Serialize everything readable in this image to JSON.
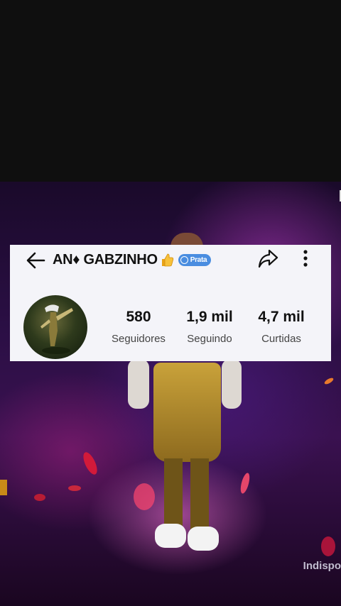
{
  "profile": {
    "username": "AN♦ GABZINHO",
    "badge_label": "Prata",
    "stats": [
      {
        "value": "580",
        "label": "Seguidores"
      },
      {
        "value": "1,9 mil",
        "label": "Seguindo"
      },
      {
        "value": "4,7 mil",
        "label": "Curtidas"
      }
    ]
  },
  "icons": {
    "back": "arrow-left-icon",
    "share": "share-icon",
    "more": "more-vertical-icon",
    "emoji": "thumbs-up-emoji"
  },
  "overlay": {
    "watermark": "Indispo"
  },
  "colors": {
    "card_bg": "#f4f4f9",
    "badge": "#4a8de0",
    "diamond": "#e2162d"
  }
}
